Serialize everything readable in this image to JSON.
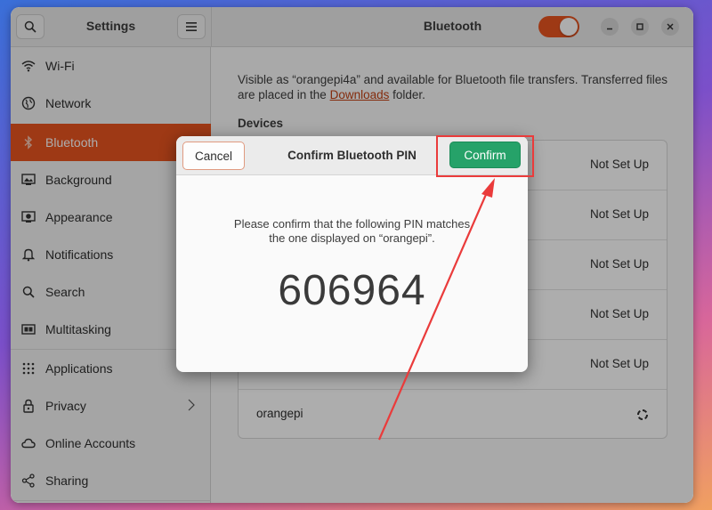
{
  "app": {
    "sidebar_title": "Settings",
    "page_title": "Bluetooth",
    "bluetooth_enabled": true
  },
  "window_controls": {
    "minimize_icon": "minimize-icon",
    "maximize_icon": "maximize-icon",
    "close_icon": "close-icon"
  },
  "sidebar": {
    "items": [
      {
        "label": "Wi-Fi",
        "icon": "wifi-icon"
      },
      {
        "label": "Network",
        "icon": "network-icon"
      },
      {
        "label": "Bluetooth",
        "icon": "bluetooth-icon",
        "active": true
      },
      {
        "label": "Background",
        "icon": "background-icon"
      },
      {
        "label": "Appearance",
        "icon": "appearance-icon"
      },
      {
        "label": "Notifications",
        "icon": "bell-icon"
      },
      {
        "label": "Search",
        "icon": "search-icon"
      },
      {
        "label": "Multitasking",
        "icon": "multitasking-icon"
      },
      {
        "label": "Applications",
        "icon": "applications-icon"
      },
      {
        "label": "Privacy",
        "icon": "lock-icon"
      },
      {
        "label": "Online Accounts",
        "icon": "cloud-icon"
      },
      {
        "label": "Sharing",
        "icon": "share-icon"
      }
    ]
  },
  "bluetooth": {
    "description_prefix": "Visible as “orangepi4a” and available for Bluetooth file transfers. Transferred files are placed in the ",
    "downloads_link": "Downloads",
    "description_suffix": " folder.",
    "devices_heading": "Devices",
    "devices": [
      {
        "name": "",
        "status": "Not Set Up"
      },
      {
        "name": "",
        "status": "Not Set Up"
      },
      {
        "name": "",
        "status": "Not Set Up"
      },
      {
        "name": "",
        "status": "Not Set Up"
      },
      {
        "name": "",
        "status": "Not Set Up"
      },
      {
        "name": "orangepi",
        "status": ""
      }
    ]
  },
  "dialog": {
    "cancel_label": "Cancel",
    "title": "Confirm Bluetooth PIN",
    "confirm_label": "Confirm",
    "message_line1": "Please confirm that the following PIN matches",
    "message_line2": "the one displayed on “orangepi”.",
    "pin": "606964"
  },
  "colors": {
    "accent": "#e95420",
    "confirm": "#26a269",
    "annotation": "#ea3b3b"
  }
}
